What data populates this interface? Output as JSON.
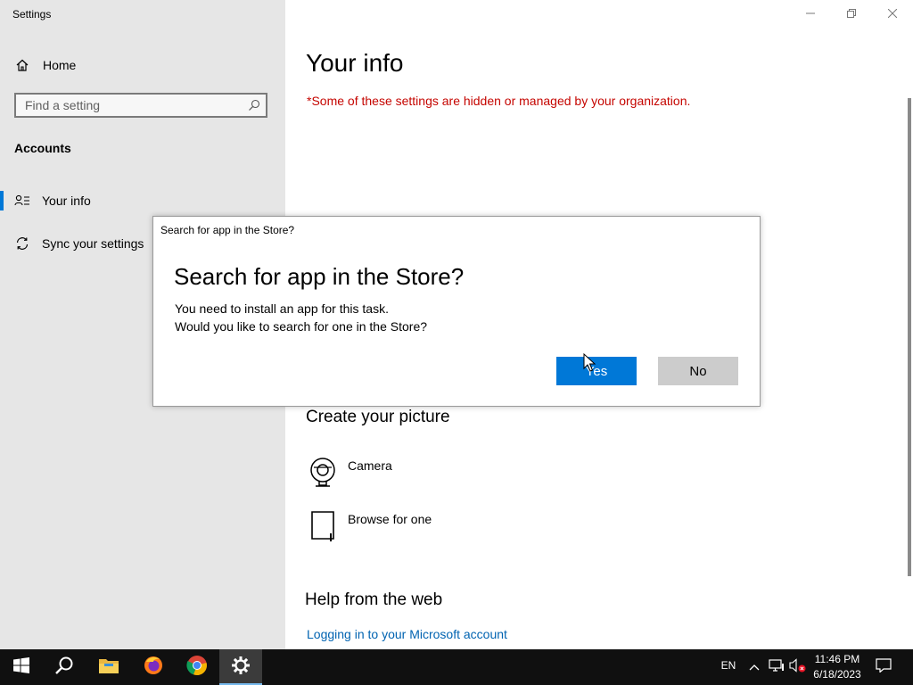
{
  "window": {
    "title": "Settings",
    "controls": [
      "minimize-icon",
      "restore-icon",
      "close-icon"
    ]
  },
  "sidebar": {
    "home_label": "Home",
    "search_placeholder": "Find a setting",
    "section_title": "Accounts",
    "items": [
      {
        "label": "Your info",
        "icon": "user-card-icon",
        "selected": true
      },
      {
        "label": "Sync your settings",
        "icon": "sync-icon",
        "selected": false
      }
    ]
  },
  "main": {
    "title": "Your info",
    "org_notice": "*Some of these settings are hidden or managed by your organization.",
    "create_picture_heading": "Create your picture",
    "picture_options": [
      {
        "label": "Camera",
        "icon": "camera-icon"
      },
      {
        "label": "Browse for one",
        "icon": "browse-file-icon"
      }
    ],
    "help_heading": "Help from the web",
    "help_link": "Logging in to your Microsoft account"
  },
  "dialog": {
    "caption": "Search for app in the Store?",
    "heading": "Search for app in the Store?",
    "line1": "You need to install an app for this task.",
    "line2": "Would you like to search for one in the Store?",
    "yes_label": "Yes",
    "no_label": "No"
  },
  "taskbar": {
    "apps": [
      "windows-start-icon",
      "search-icon",
      "file-explorer-icon",
      "firefox-icon",
      "chrome-icon",
      "settings-gear-icon"
    ],
    "language": "EN",
    "time": "11:46 PM",
    "date": "6/18/2023"
  },
  "colors": {
    "accent": "#0078d7",
    "notice_red": "#c50500",
    "link": "#0063b1",
    "sidebar_bg": "#e6e6e6",
    "taskbar_bg": "#101010"
  }
}
